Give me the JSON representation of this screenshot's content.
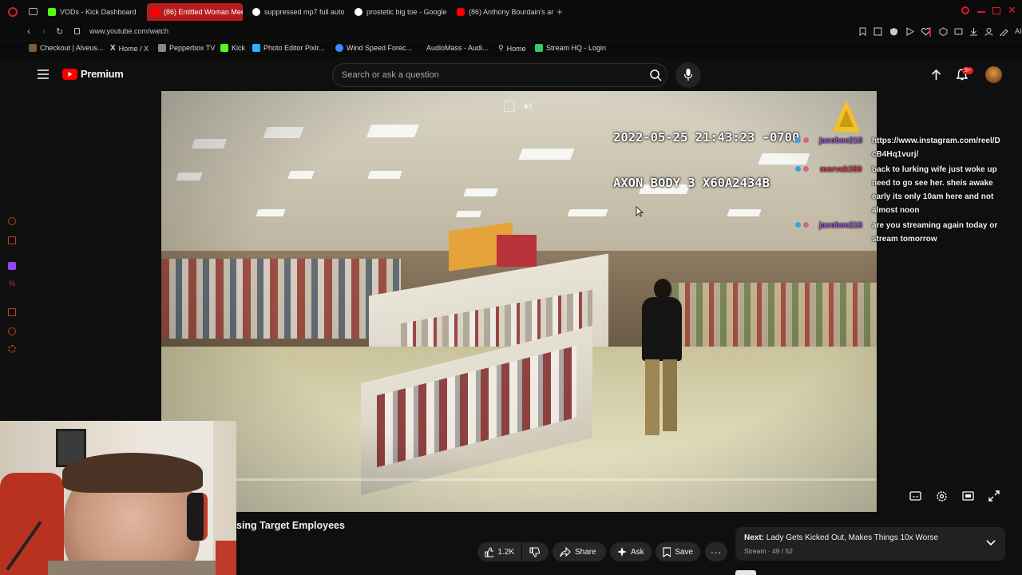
{
  "browser": {
    "tabs": [
      {
        "title": "VODs - Kick Dashboard",
        "color": "#53fc18"
      },
      {
        "title": "(86) Entitled Woman Meets",
        "color": "#ff0000"
      },
      {
        "title": "suppressed mp7 full auto",
        "color": "#ffffff"
      },
      {
        "title": "prostetic big toe - Google",
        "color": "#ffffff"
      },
      {
        "title": "(86) Anthony Bourdain's ar",
        "color": "#ff0000"
      }
    ],
    "url": "www.youtube.com/watch",
    "bookmarks": [
      {
        "label": "Checkout | Alveus...",
        "color": "#7a5c3a"
      },
      {
        "label": "Home / X",
        "color": "#ffffff"
      },
      {
        "label": "Pepperbox TV",
        "color": "#888888"
      },
      {
        "label": "Kick",
        "color": "#53fc18"
      },
      {
        "label": "Photo Editor Pixlr...",
        "color": "#1fb6ff"
      },
      {
        "label": "Wind Speed Forec...",
        "color": "#3a8bff"
      },
      {
        "label": "AudioMass - Audi...",
        "color": "#222222"
      },
      {
        "label": "Home",
        "color": "#cccccc"
      },
      {
        "label": "Stream HQ - Login",
        "color": "#2ecc71"
      }
    ]
  },
  "youtube": {
    "logo_text": "Premium",
    "search_placeholder": "Search or ask a question",
    "notification_count": "9+",
    "video": {
      "timestamp_line1": "2022-05-25 21:43:23 -0700",
      "timestamp_line2": "AXON BODY 3 X60A2434B",
      "title_visible": "sing Target Employees"
    },
    "actions": {
      "likes": "1.2K",
      "share": "Share",
      "ask": "Ask",
      "save": "Save"
    },
    "next": {
      "label": "Next:",
      "title": "Lady Gets Kicked Out, Makes Things 10x Worse",
      "playlist": "Stream · 49 / 52"
    }
  },
  "chat": [
    {
      "user": "jacobee218",
      "user_color": "#9b59d0",
      "lines": [
        "https://www.instagram.com/reel/D",
        "cB4Hq1vurj/"
      ]
    },
    {
      "user": "morvak359",
      "user_color": "#e0465a",
      "lines": [
        "back to lurking wife just woke up",
        "need to go see her. sheis awake",
        "early its only 10am here and not",
        "almost noon"
      ]
    },
    {
      "user": "jacobee218",
      "user_color": "#9b59d0",
      "lines": [
        "are you streaming again today or",
        "stream tomorrow"
      ]
    }
  ]
}
